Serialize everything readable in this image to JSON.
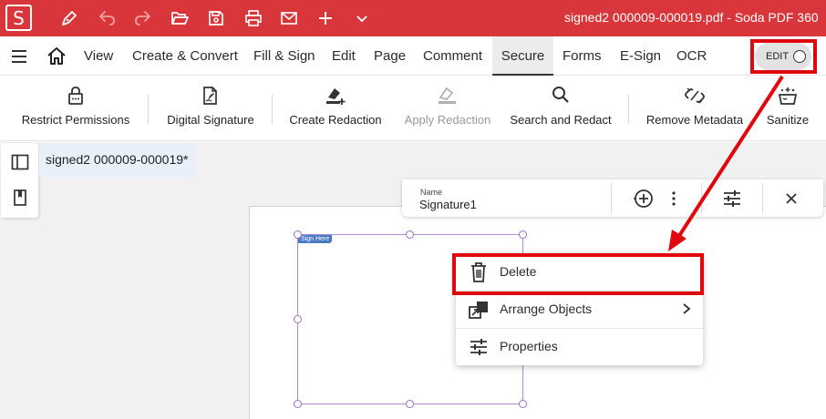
{
  "titlebar": {
    "logo": "S",
    "doc_title": "signed2 000009-000019.pdf   -   Soda PDF 360",
    "icons": [
      "pen-icon",
      "undo-icon",
      "redo-icon",
      "folder-open-icon",
      "save-icon",
      "print-icon",
      "mail-icon",
      "plus-icon",
      "chevron-down-icon"
    ],
    "color": "#d8363a"
  },
  "menu": {
    "items": [
      "View",
      "Create & Convert",
      "Fill & Sign",
      "Edit",
      "Page",
      "Comment",
      "Secure",
      "Forms",
      "E-Sign",
      "OCR"
    ],
    "active": "Secure",
    "edit_toggle": "EDIT"
  },
  "toolbar": {
    "tools": [
      {
        "label": "Restrict Permissions",
        "icon": "lock-icon",
        "disabled": false
      },
      {
        "label": "Digital Signature",
        "icon": "document-pen-icon",
        "disabled": false
      },
      {
        "label": "Create Redaction",
        "icon": "eraser-plus-icon",
        "disabled": false
      },
      {
        "label": "Apply Redaction",
        "icon": "eraser-icon",
        "disabled": true
      },
      {
        "label": "Search and Redact",
        "icon": "search-icon",
        "disabled": false
      },
      {
        "label": "Remove Metadata",
        "icon": "unlink-icon",
        "disabled": false
      },
      {
        "label": "Sanitize",
        "icon": "bucket-sparkle-icon",
        "disabled": false
      }
    ]
  },
  "document_tab": "signed2 000009-000019*",
  "signature_bar": {
    "name_label": "Name",
    "name_value": "Signature1",
    "icons": [
      "add-circle-icon",
      "more-vertical-icon",
      "sliders-icon",
      "close-icon"
    ]
  },
  "field": {
    "tag": "Sign Here",
    "border_color": "#b28bd2"
  },
  "context_menu": {
    "items": [
      {
        "label": "Delete",
        "icon": "trash-icon"
      },
      {
        "label": "Arrange Objects",
        "icon": "arrange-icon"
      },
      {
        "label": "Properties",
        "icon": "sliders-icon"
      }
    ]
  },
  "annotation_color": "#e0070d"
}
